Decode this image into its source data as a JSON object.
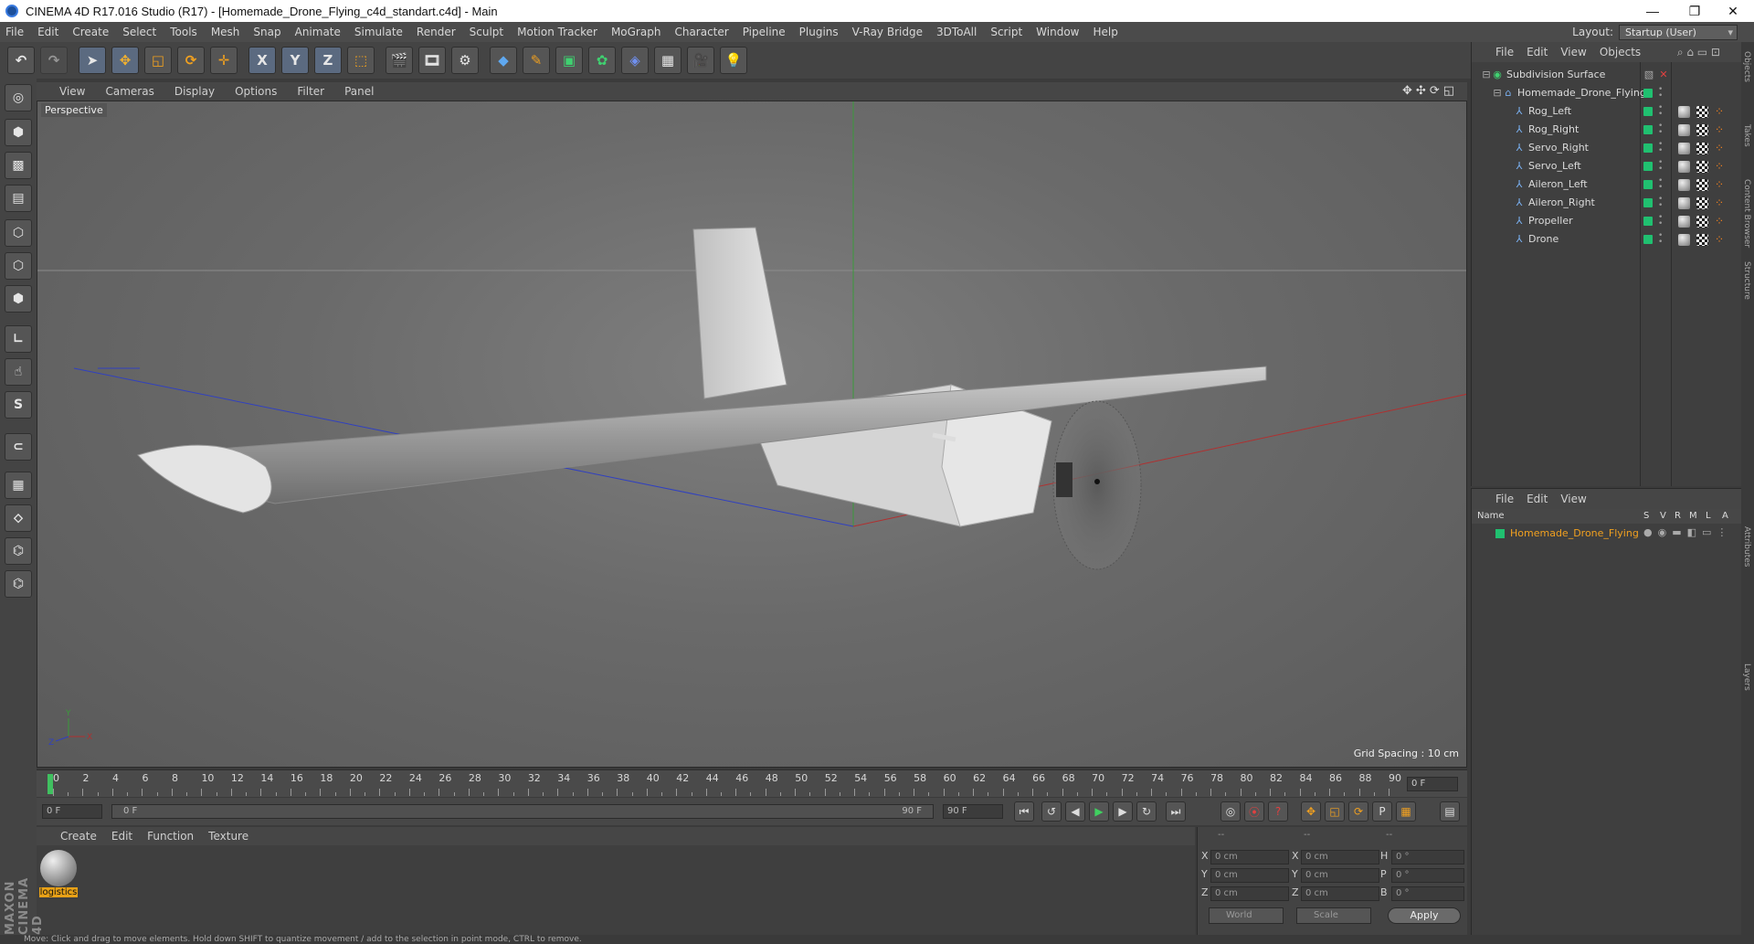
{
  "window": {
    "title": "CINEMA 4D R17.016 Studio (R17) - [Homemade_Drone_Flying_c4d_standart.c4d] - Main"
  },
  "menubar": [
    "File",
    "Edit",
    "Create",
    "Select",
    "Tools",
    "Mesh",
    "Snap",
    "Animate",
    "Simulate",
    "Render",
    "Sculpt",
    "Motion Tracker",
    "MoGraph",
    "Character",
    "Pipeline",
    "Plugins",
    "V-Ray Bridge",
    "3DToAll",
    "Script",
    "Window",
    "Help"
  ],
  "layout": {
    "label": "Layout:",
    "value": "Startup (User)"
  },
  "toolbar": {
    "axis_x": "X",
    "axis_y": "Y",
    "axis_z": "Z"
  },
  "viewport": {
    "menu": [
      "View",
      "Cameras",
      "Display",
      "Options",
      "Filter",
      "Panel"
    ],
    "camera_label": "Perspective",
    "grid_spacing": "Grid Spacing : 10 cm"
  },
  "timeline": {
    "ticks": [
      "0",
      "2",
      "4",
      "6",
      "8",
      "10",
      "12",
      "14",
      "16",
      "18",
      "20",
      "22",
      "24",
      "26",
      "28",
      "30",
      "32",
      "34",
      "36",
      "38",
      "40",
      "42",
      "44",
      "46",
      "48",
      "50",
      "52",
      "54",
      "56",
      "58",
      "60",
      "62",
      "64",
      "66",
      "68",
      "70",
      "72",
      "74",
      "76",
      "78",
      "80",
      "82",
      "84",
      "86",
      "88",
      "90"
    ],
    "end_frame_field": "0 F"
  },
  "playbar": {
    "current": "0 F",
    "range_start": "0 F",
    "range_end": "90 F",
    "max": "90 F"
  },
  "material_manager": {
    "menu": [
      "Create",
      "Edit",
      "Function",
      "Texture"
    ],
    "materials": [
      {
        "name": "logistics"
      }
    ]
  },
  "coordinates": {
    "headers": [
      "--",
      "--",
      "--"
    ],
    "rows": [
      {
        "k1": "X",
        "v1": "0 cm",
        "k2": "X",
        "v2": "0 cm",
        "k3": "H",
        "v3": "0 °"
      },
      {
        "k1": "Y",
        "v1": "0 cm",
        "k2": "Y",
        "v2": "0 cm",
        "k3": "P",
        "v3": "0 °"
      },
      {
        "k1": "Z",
        "v1": "0 cm",
        "k2": "Z",
        "v2": "0 cm",
        "k3": "B",
        "v3": "0 °"
      }
    ],
    "mode": "World",
    "type": "Scale",
    "apply": "Apply"
  },
  "brand": "MAXON CINEMA 4D",
  "status_text": "Move: Click and drag to move elements. Hold down SHIFT to quantize movement / add to the selection in point mode, CTRL to remove.",
  "object_manager": {
    "menu": [
      "File",
      "Edit",
      "View",
      "Objects"
    ],
    "objects": [
      {
        "name": "Subdivision Surface",
        "level": 0
      },
      {
        "name": "Homemade_Drone_Flying",
        "level": 1
      },
      {
        "name": "Rog_Left",
        "level": 2
      },
      {
        "name": "Rog_Right",
        "level": 2
      },
      {
        "name": "Servo_Right",
        "level": 2
      },
      {
        "name": "Servo_Left",
        "level": 2
      },
      {
        "name": "Aileron_Left",
        "level": 2
      },
      {
        "name": "Aileron_Right",
        "level": 2
      },
      {
        "name": "Propeller",
        "level": 2
      },
      {
        "name": "Drone",
        "level": 2
      }
    ]
  },
  "layer_manager": {
    "menu": [
      "File",
      "Edit",
      "View"
    ],
    "columns": [
      "Name",
      "S",
      "V",
      "R",
      "M",
      "L",
      "A"
    ],
    "layers": [
      {
        "name": "Homemade_Drone_Flying",
        "color": "#20c070"
      }
    ]
  },
  "side_tabs": [
    "Objects",
    "Takes",
    "Content Browser",
    "Structure",
    "Attributes",
    "Layers"
  ],
  "colors": {
    "accent_orange": "#e8a117",
    "layer_green": "#20c070",
    "x_axis": "#c03030",
    "y_axis": "#30a030",
    "z_axis": "#3040c0"
  }
}
